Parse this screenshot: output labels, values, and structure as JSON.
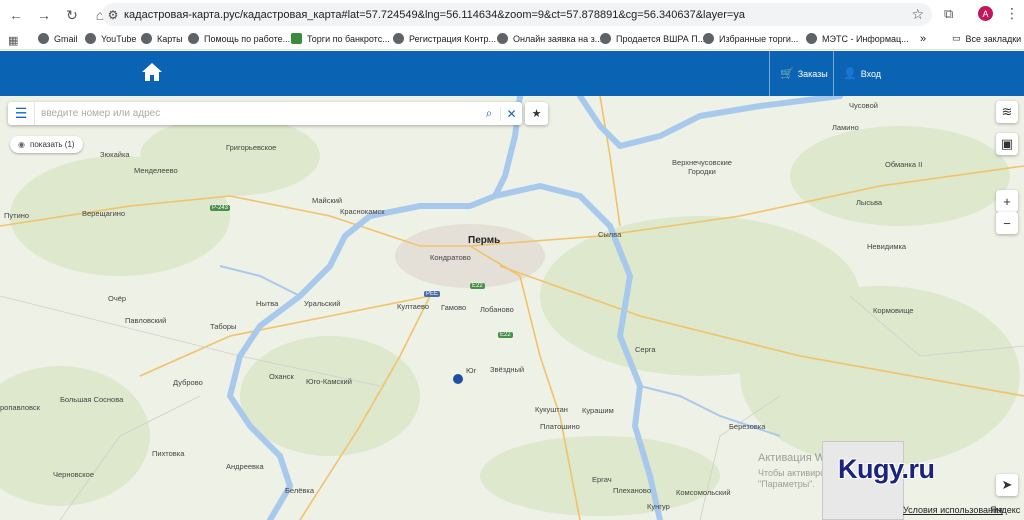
{
  "browser": {
    "url": "кадастровая-карта.рус/кадастровая_карта#lat=57.724549&lng=56.114634&zoom=9&ct=57.878891&cg=56.340637&layer=ya",
    "avatar_letter": "A",
    "bookmarks": [
      {
        "label": "Gmail"
      },
      {
        "label": "YouTube"
      },
      {
        "label": "Карты"
      },
      {
        "label": "Помощь по работе..."
      },
      {
        "label": "Торги по банкротс..."
      },
      {
        "label": "Регистрация Контр..."
      },
      {
        "label": "Онлайн заявка на з..."
      },
      {
        "label": "Продается ВШРА П..."
      },
      {
        "label": "Избранные торги..."
      },
      {
        "label": "МЭТС - Информац..."
      }
    ],
    "more_chevron": "»",
    "all_bookmarks": "Все закладки"
  },
  "header": {
    "orders_label": "Заказы",
    "login_label": "Вход",
    "brand_color": "#0a63b3"
  },
  "search": {
    "placeholder": "введите номер или адрес"
  },
  "show_chip": "показать (1)",
  "map": {
    "places": [
      {
        "name": "Пермь",
        "big": true
      },
      {
        "name": "Краснокамск",
        "big": false
      },
      {
        "name": "Кондратово",
        "big": false
      },
      {
        "name": "Култаево",
        "big": false
      },
      {
        "name": "Гамово",
        "big": false
      },
      {
        "name": "Лобаново",
        "big": false
      },
      {
        "name": "Юг",
        "big": false
      },
      {
        "name": "Звёздный",
        "big": false
      },
      {
        "name": "Кукуштан",
        "big": false
      },
      {
        "name": "Курашим",
        "big": false
      },
      {
        "name": "Платошино",
        "big": false
      },
      {
        "name": "Юго-Камский",
        "big": false
      },
      {
        "name": "Оханск",
        "big": false
      },
      {
        "name": "Нытва",
        "big": false
      },
      {
        "name": "Уральский",
        "big": false
      },
      {
        "name": "Майский",
        "big": false
      },
      {
        "name": "Григорьевское",
        "big": false
      },
      {
        "name": "Менделеево",
        "big": false
      },
      {
        "name": "Зюкайка",
        "big": false
      },
      {
        "name": "Верещагино",
        "big": false
      },
      {
        "name": "Путино",
        "big": false
      },
      {
        "name": "Очёр",
        "big": false
      },
      {
        "name": "Павловский",
        "big": false
      },
      {
        "name": "Таборы",
        "big": false
      },
      {
        "name": "Дуброво",
        "big": false
      },
      {
        "name": "Большая Соснова",
        "big": false
      },
      {
        "name": "ропавловск",
        "big": false
      },
      {
        "name": "Пихтовка",
        "big": false
      },
      {
        "name": "Черновское",
        "big": false
      },
      {
        "name": "Андреевка",
        "big": false
      },
      {
        "name": "Белёвка",
        "big": false
      },
      {
        "name": "Сылва",
        "big": false
      },
      {
        "name": "Серга",
        "big": false
      },
      {
        "name": "Верхнечусовские Городки",
        "big": false
      },
      {
        "name": "Чусовой",
        "big": false
      },
      {
        "name": "Ламино",
        "big": false
      },
      {
        "name": "Обманка II",
        "big": false
      },
      {
        "name": "Лысьва",
        "big": false
      },
      {
        "name": "Невидимка",
        "big": false
      },
      {
        "name": "Кормовище",
        "big": false
      },
      {
        "name": "Березовка",
        "big": false
      },
      {
        "name": "Ергач",
        "big": false
      },
      {
        "name": "Плеханово",
        "big": false
      },
      {
        "name": "Комсомольский",
        "big": false
      },
      {
        "name": "Кунгур",
        "big": false
      },
      {
        "name": "Кунгур",
        "big": false
      }
    ],
    "road_badges": [
      "P-243",
      "E22",
      "E22",
      "PEE"
    ],
    "map_marker_color": "#1e4fa3"
  },
  "overlays": {
    "win_activation_title": "Активация W",
    "win_activation_sub1": "Чтобы активиров",
    "win_activation_sub2": "\"Параметры\".",
    "kugy_logo": "Kugy.ru",
    "terms": "Условия использования",
    "yandex": "Яндекс"
  }
}
